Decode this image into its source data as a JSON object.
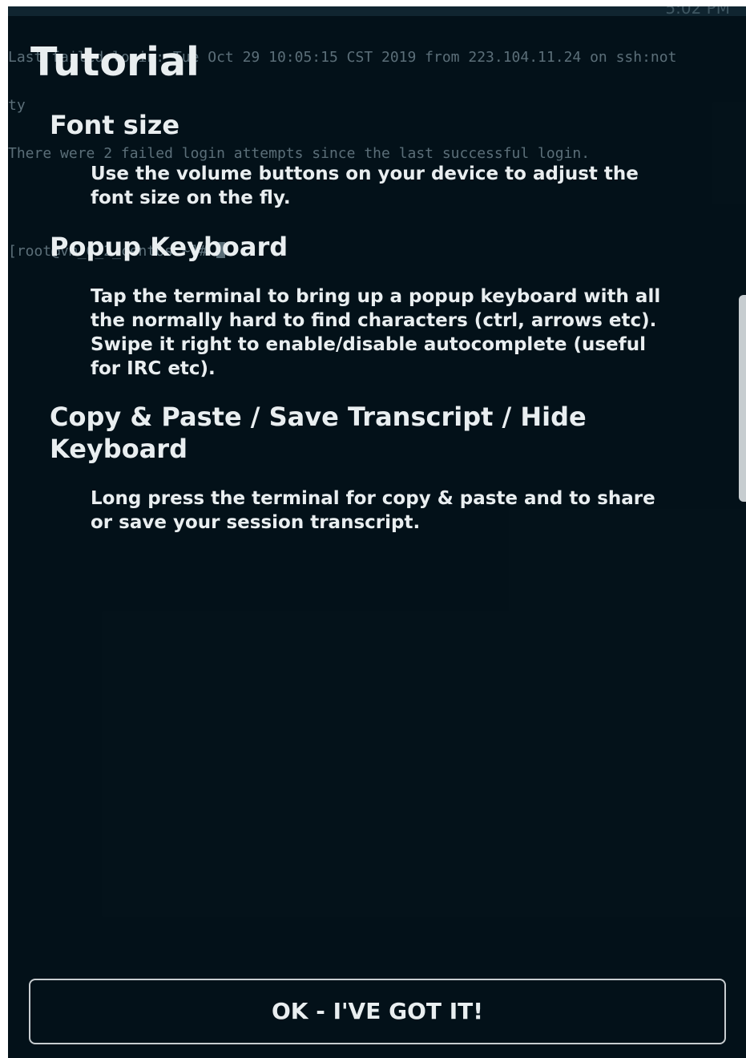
{
  "status_bar": {
    "text": "5:02 PM"
  },
  "terminal": {
    "lines": [
      "Last failed login: Tue Oct 29 10:05:15 CST 2019 from 223.104.11.24 on ssh:not",
      "ty",
      "There were 2 failed login attempts since the last successful login.",
      "",
      "[root@vm_0_2_centos ~]#"
    ]
  },
  "tutorial": {
    "title": "Tutorial",
    "sections": [
      {
        "heading": "Font size",
        "body": "Use the volume buttons on your device to adjust the font size on the fly."
      },
      {
        "heading": "Popup Keyboard",
        "body": "Tap the terminal to bring up a popup keyboard with all the normally hard to find characters (ctrl, arrows etc). Swipe it right to enable/disable autocomplete (useful for IRC etc)."
      },
      {
        "heading": "Copy & Paste / Save Transcript / Hide Keyboard",
        "body": "Long press the terminal for copy & paste and to share or save your session transcript."
      }
    ],
    "confirm_label": "OK - I'VE GOT IT!"
  }
}
